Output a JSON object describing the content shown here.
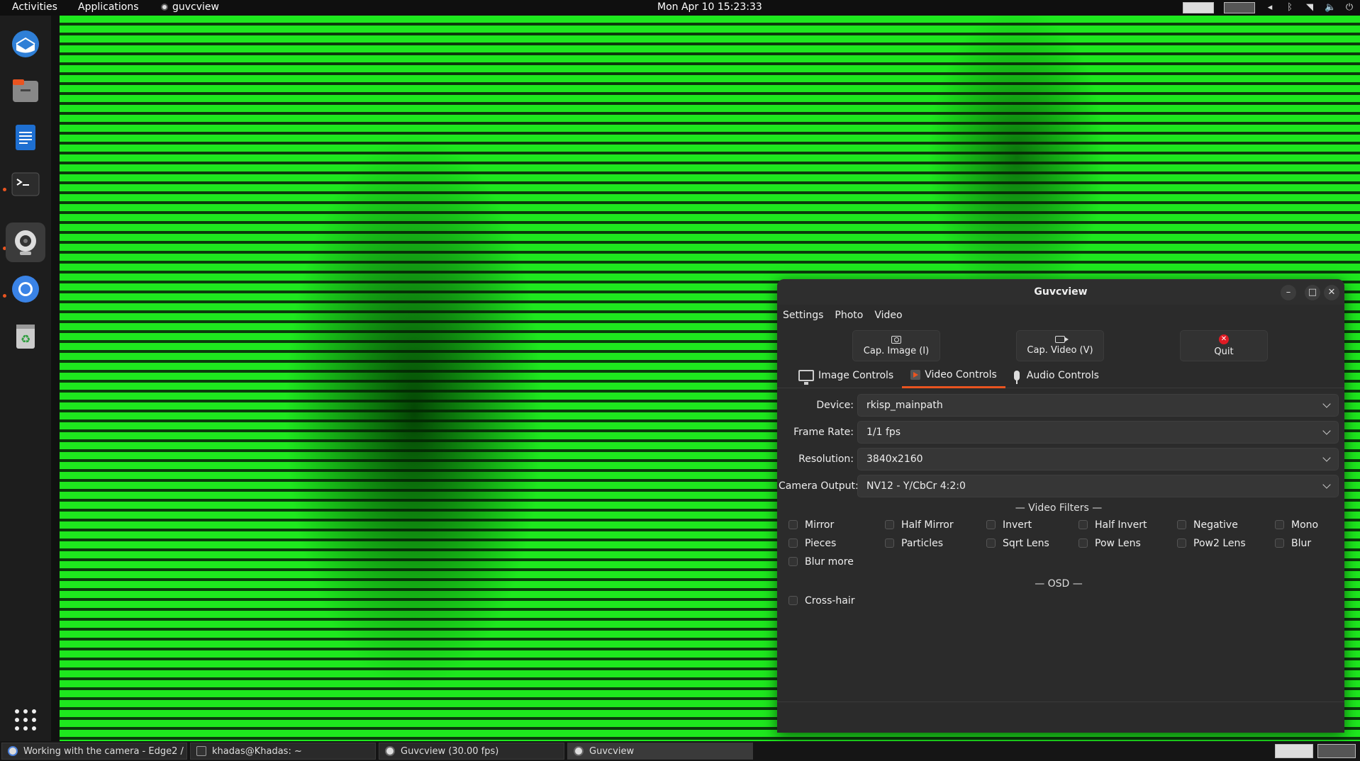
{
  "topbar": {
    "activities": "Activities",
    "applications": "Applications",
    "app_name": "guvcview",
    "clock": "Mon Apr 10  15:23:33"
  },
  "dock": {
    "apps": [
      "thunderbird-icon",
      "files-icon",
      "writer-icon",
      "terminal-icon",
      "webcam-icon",
      "chromium-icon",
      "trash-icon",
      "app-grid-icon"
    ]
  },
  "window": {
    "title": "Guvcview",
    "menu": [
      "Settings",
      "Photo",
      "Video"
    ],
    "toolbar": {
      "cap_image": "Cap. Image (I)",
      "cap_video": "Cap. Video (V)",
      "quit": "Quit"
    },
    "tabs": [
      "Image Controls",
      "Video Controls",
      "Audio Controls"
    ],
    "active_tab": "Video Controls",
    "fields": {
      "device_label": "Device:",
      "device_value": "rkisp_mainpath",
      "framerate_label": "Frame Rate:",
      "framerate_value": "1/1 fps",
      "resolution_label": "Resolution:",
      "resolution_value": "3840x2160",
      "output_label": "Camera Output:",
      "output_value": "NV12 - Y/CbCr 4:2:0"
    },
    "filters_title": "— Video Filters —",
    "filters": [
      "Mirror",
      "Half Mirror",
      "Invert",
      "Half Invert",
      "Negative",
      "Mono",
      "Pieces",
      "Particles",
      "Sqrt Lens",
      "Pow Lens",
      "Pow2 Lens",
      "Blur",
      "Blur more"
    ],
    "osd_title": "— OSD —",
    "osd": [
      "Cross-hair"
    ]
  },
  "taskbar": {
    "tasks": [
      "Working with the camera - Edge2 / ...",
      "khadas@Khadas: ~",
      "Guvcview  (30.00 fps)",
      "Guvcview"
    ]
  },
  "colors": {
    "accent": "#e95420",
    "preview_green": "#1ee81e",
    "window_bg": "#2b2b2b"
  }
}
